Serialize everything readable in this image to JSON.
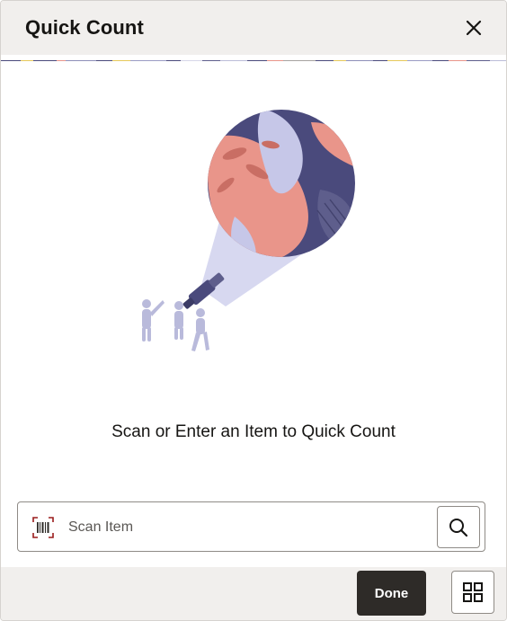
{
  "dialog": {
    "title": "Quick Count",
    "close_icon": "close-icon"
  },
  "empty_state": {
    "illustration": "telescope-illustration",
    "message": "Scan or Enter an Item to Quick Count"
  },
  "scan": {
    "icon": "barcode-icon",
    "placeholder": "Scan Item",
    "value": "",
    "search_icon": "search-icon"
  },
  "footer": {
    "done_label": "Done",
    "grid_icon": "grid-icon"
  },
  "colors": {
    "header_bg": "#f1efed",
    "done_bg": "#2e2b28",
    "illustration_navy": "#4a4a7c",
    "illustration_coral": "#e9958a",
    "illustration_lavender": "#c6c7e8"
  }
}
